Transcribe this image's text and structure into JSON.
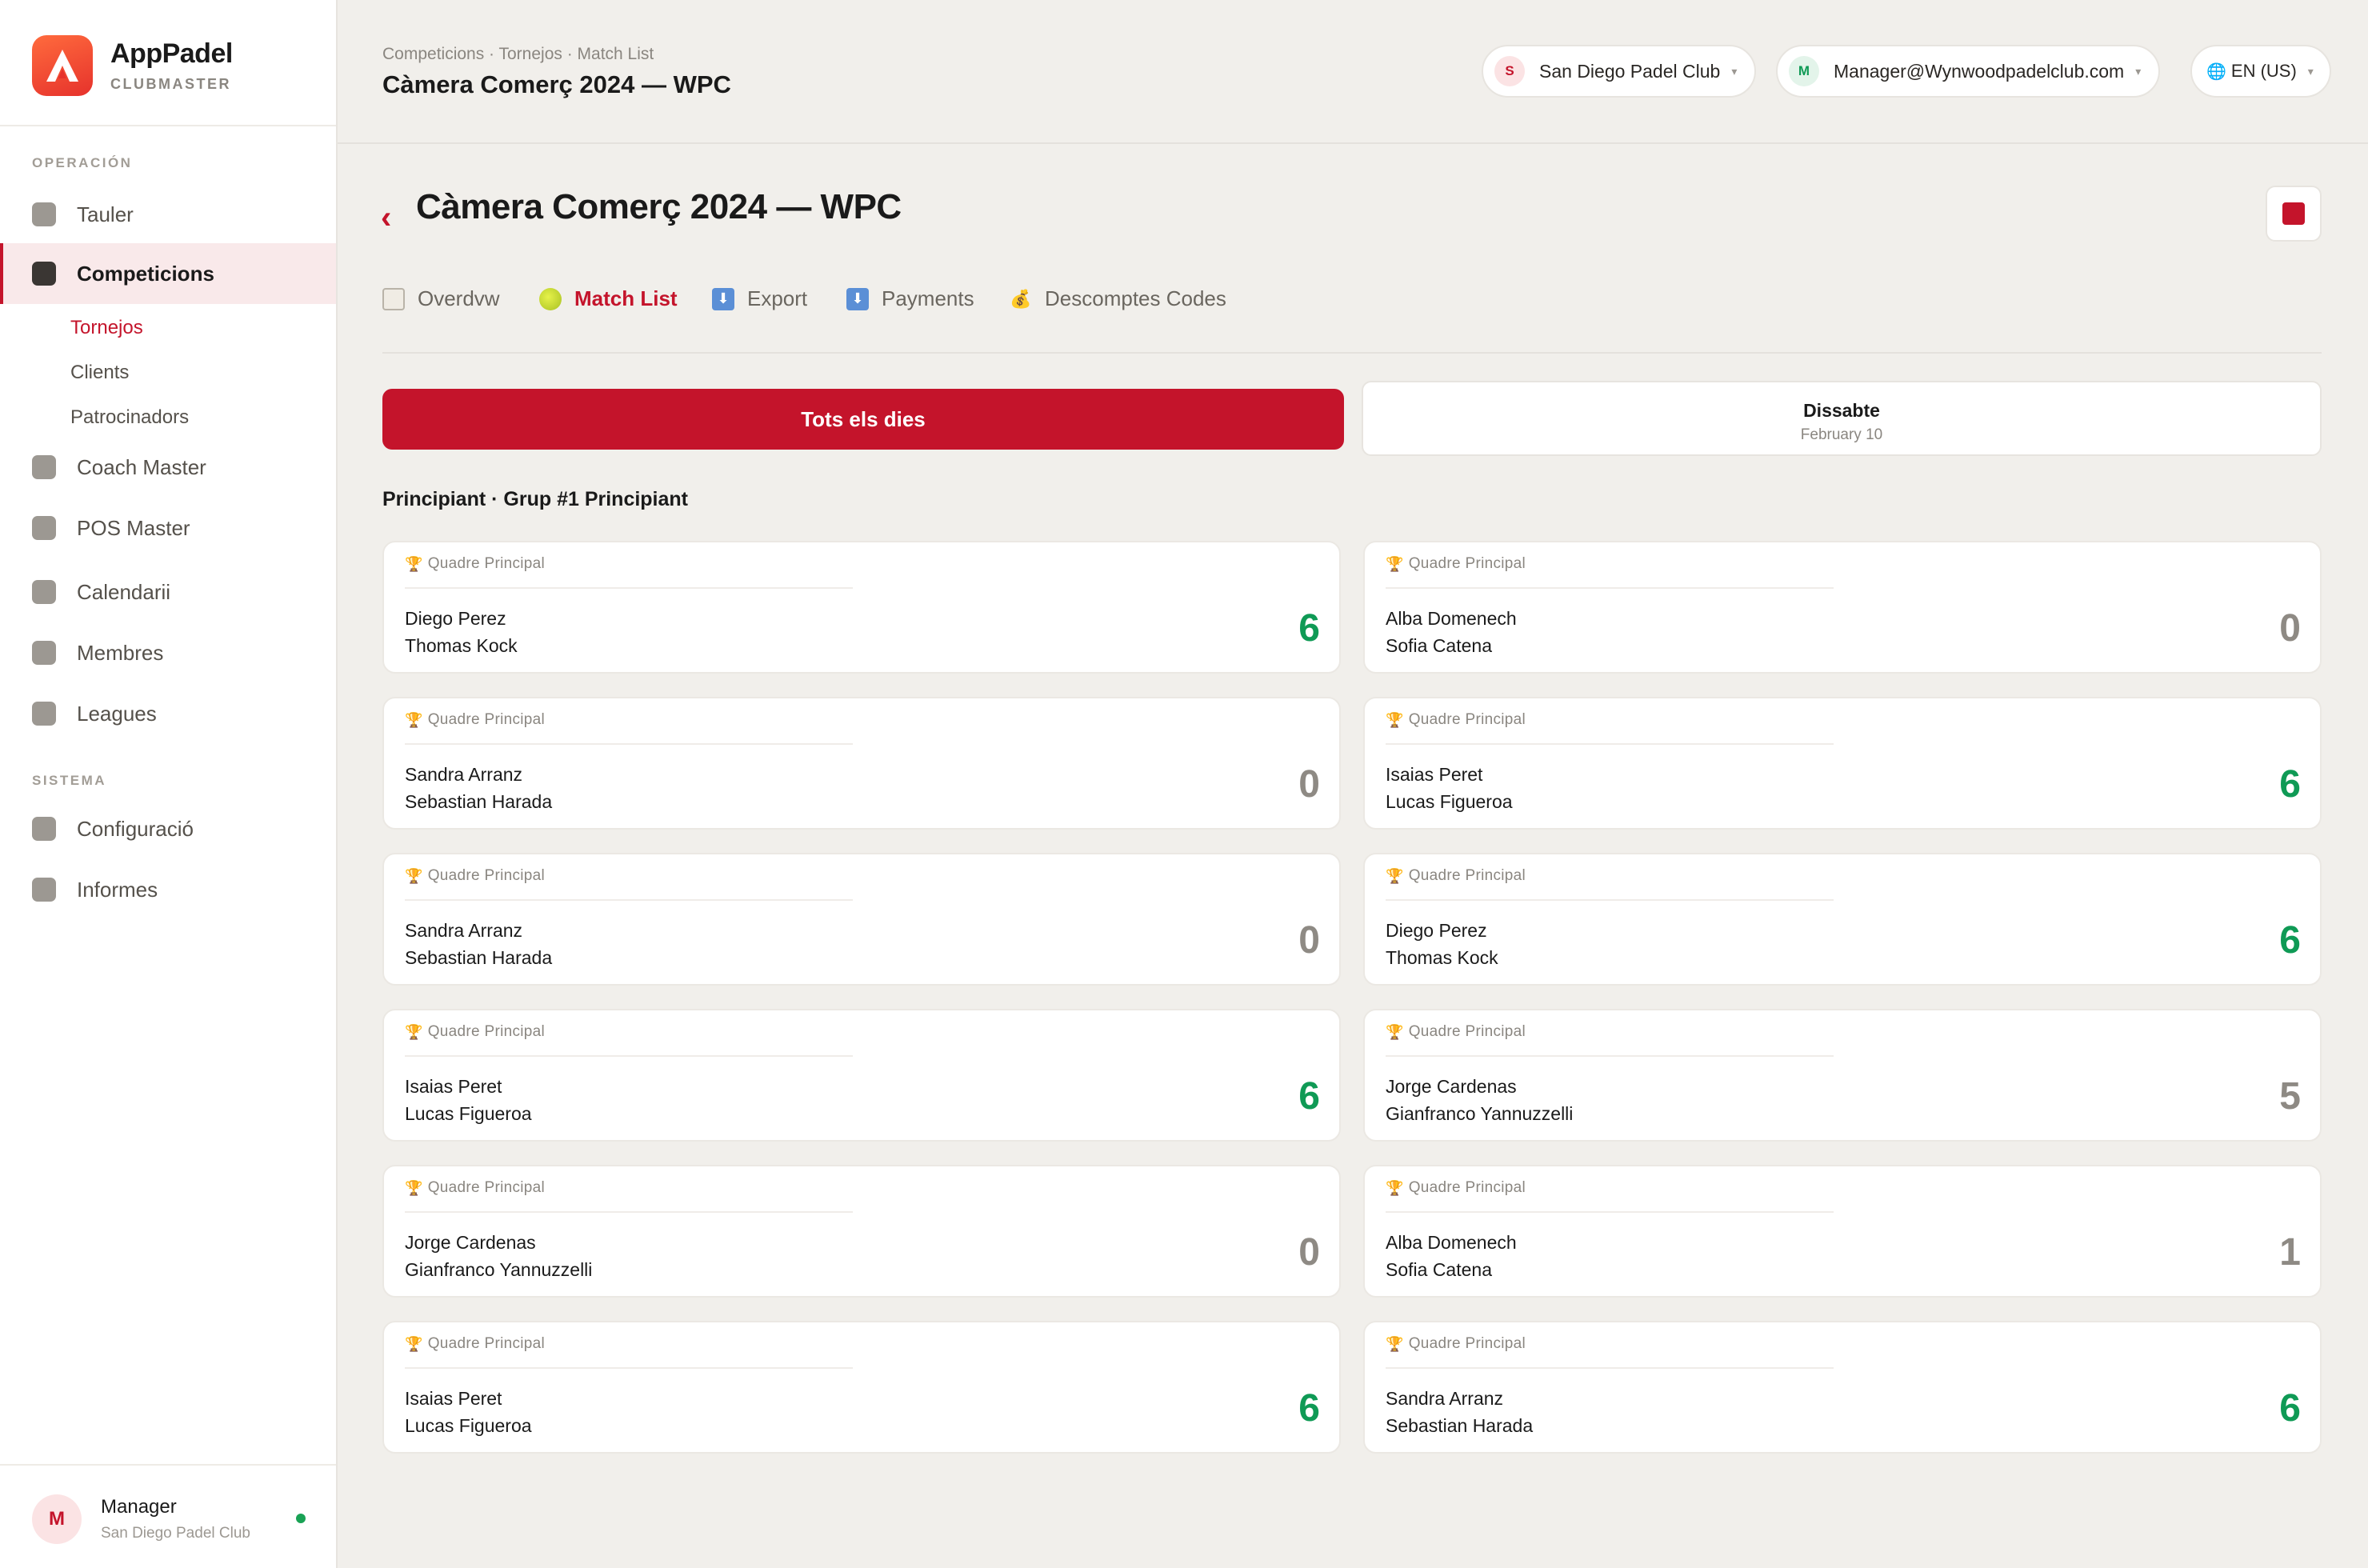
{
  "brand": {
    "name": "AppPadel",
    "sub": "CLUBMASTER"
  },
  "sidebar": {
    "section_operacion": "OPERACIÓN",
    "section_sistema": "SISTEMA",
    "items": [
      {
        "label": "Tauler"
      },
      {
        "label": "Competicions"
      },
      {
        "label": "Coach Master"
      },
      {
        "label": "POS Master"
      },
      {
        "label": "Calendarii"
      },
      {
        "label": "Membres"
      },
      {
        "label": "Leagues"
      },
      {
        "label": "Configuració"
      },
      {
        "label": "Informes"
      }
    ],
    "subitems": [
      {
        "label": "Tornejos"
      },
      {
        "label": "Clients"
      },
      {
        "label": "Patrocinadors"
      }
    ]
  },
  "user": {
    "initial": "M",
    "name": "Manager",
    "club": "San Diego Padel Club"
  },
  "header": {
    "breadcrumb": "Competicions · Tornejos · Match List",
    "title": "Càmera Comerç 2024 — WPC",
    "club_pill": {
      "initial": "S",
      "label": "San Diego Padel Club"
    },
    "user_pill": {
      "initial": "M",
      "label": "Manager@Wynwoodpadelclub.com"
    },
    "lang_pill": {
      "label": "EN (US)"
    }
  },
  "page": {
    "back": "‹",
    "title": "Càmera Comerç 2024 — WPC",
    "tabs": [
      {
        "label": "Overdvw"
      },
      {
        "label": "Match List"
      },
      {
        "label": "Export"
      },
      {
        "label": "Payments"
      },
      {
        "label": "Descomptes Codes"
      }
    ],
    "day_all": "Tots els dies",
    "day_1": {
      "name": "Dissabte",
      "date": "February 10"
    },
    "group": "Principiant · Grup #1 Principiant"
  },
  "colors": {
    "accent": "#c4142b",
    "win": "#0f9a55",
    "lose": "#8e8a84"
  },
  "matches": [
    {
      "category": "Quadre Principal",
      "p1": "Diego Perez",
      "p2": "Thomas Kock",
      "score": "6",
      "win": true
    },
    {
      "category": "Quadre Principal",
      "p1": "Alba Domenech",
      "p2": "Sofia Catena",
      "score": "0",
      "win": false
    },
    {
      "category": "Quadre Principal",
      "p1": "Sandra Arranz",
      "p2": "Sebastian Harada",
      "score": "0",
      "win": false
    },
    {
      "category": "Quadre Principal",
      "p1": "Isaias Peret",
      "p2": "Lucas Figueroa",
      "score": "6",
      "win": true
    },
    {
      "category": "Quadre Principal",
      "p1": "Sandra Arranz",
      "p2": "Sebastian Harada",
      "score": "0",
      "win": false
    },
    {
      "category": "Quadre Principal",
      "p1": "Diego Perez",
      "p2": "Thomas Kock",
      "score": "6",
      "win": true
    },
    {
      "category": "Quadre Principal",
      "p1": "Isaias Peret",
      "p2": "Lucas Figueroa",
      "score": "6",
      "win": true
    },
    {
      "category": "Quadre Principal",
      "p1": "Jorge Cardenas",
      "p2": "Gianfranco Yannuzzelli",
      "score": "5",
      "win": false
    },
    {
      "category": "Quadre Principal",
      "p1": "Jorge Cardenas",
      "p2": "Gianfranco Yannuzzelli",
      "score": "0",
      "win": false
    },
    {
      "category": "Quadre Principal",
      "p1": "Alba Domenech",
      "p2": "Sofia Catena",
      "score": "1",
      "win": false
    },
    {
      "category": "Quadre Principal",
      "p1": "Isaias Peret",
      "p2": "Lucas Figueroa",
      "score": "6",
      "win": true
    },
    {
      "category": "Quadre Principal",
      "p1": "Sandra Arranz",
      "p2": "Sebastian Harada",
      "score": "6",
      "win": true
    }
  ]
}
